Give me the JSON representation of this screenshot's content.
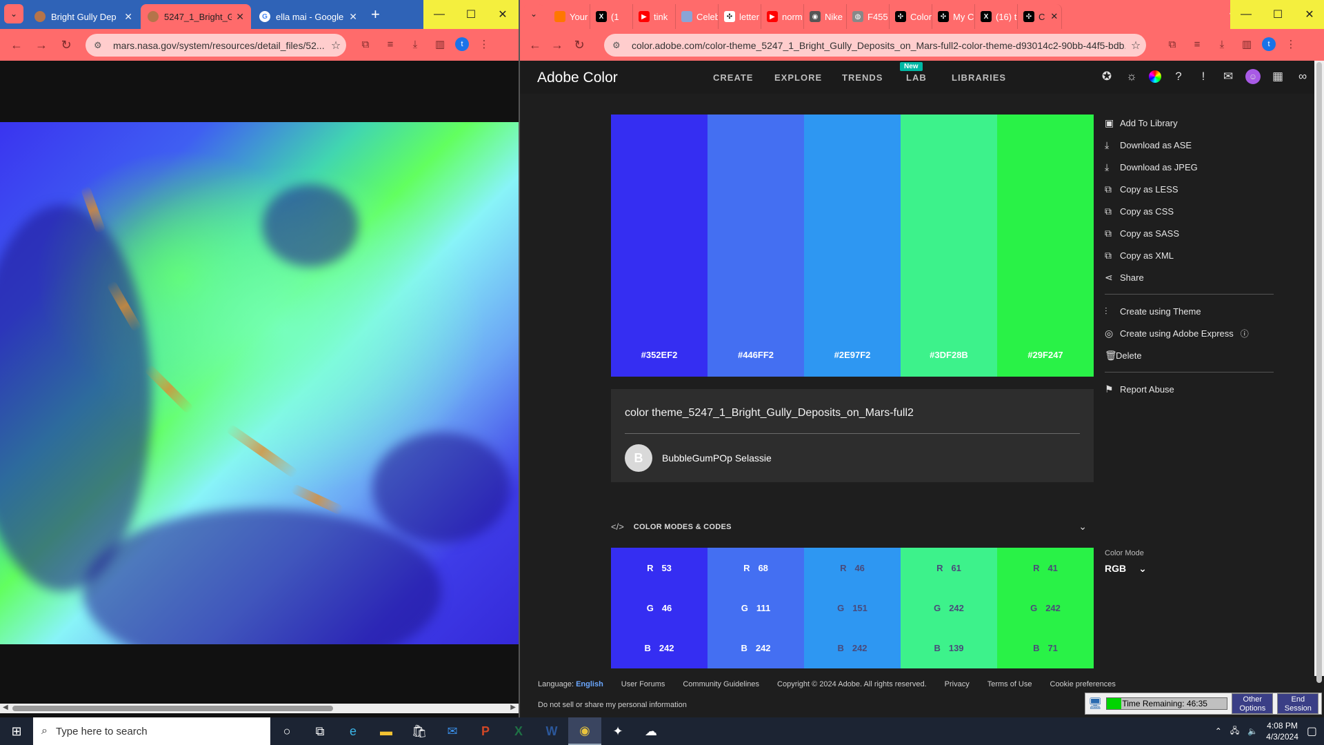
{
  "left_window": {
    "tabs": [
      {
        "title": "Bright Gully Dep",
        "favicon": "planet"
      },
      {
        "title": "5247_1_Bright_G",
        "favicon": "planet",
        "active": true
      },
      {
        "title": "ella mai - Google",
        "favicon": "google"
      }
    ],
    "url": "mars.nasa.gov/system/resources/detail_files/52...",
    "profile_letter": "t"
  },
  "right_window": {
    "tabs": [
      {
        "title": "Your",
        "favicon": "soundcloud"
      },
      {
        "title": "(1",
        "favicon": "x"
      },
      {
        "title": "tink",
        "favicon": "youtube"
      },
      {
        "title": "Celeb",
        "favicon": "pattern"
      },
      {
        "title": "letter",
        "favicon": "openai"
      },
      {
        "title": "norm",
        "favicon": "youtube"
      },
      {
        "title": "Nike",
        "favicon": "eye"
      },
      {
        "title": "F455",
        "favicon": "globe"
      },
      {
        "title": "Color",
        "favicon": "openai"
      },
      {
        "title": "My C",
        "favicon": "openai"
      },
      {
        "title": "(16) t",
        "favicon": "x"
      },
      {
        "title": "C",
        "favicon": "openai",
        "active": true
      }
    ],
    "url": "color.adobe.com/color-theme_5247_1_Bright_Gully_Deposits_on_Mars-full2-color-theme-d93014c2-90bb-44f5-bdb...",
    "profile_letter": "t"
  },
  "adobe": {
    "brand": "Adobe Color",
    "nav": [
      "CREATE",
      "EXPLORE",
      "TRENDS",
      "LAB",
      "LIBRARIES"
    ],
    "new_badge": "New",
    "swatches": [
      {
        "hex": "#352EF2",
        "r": "53",
        "g": "46",
        "b": "242"
      },
      {
        "hex": "#446FF2",
        "r": "68",
        "g": "111",
        "b": "242"
      },
      {
        "hex": "#2E97F2",
        "r": "46",
        "g": "151",
        "b": "242"
      },
      {
        "hex": "#3DF28B",
        "r": "61",
        "g": "242",
        "b": "139"
      },
      {
        "hex": "#29F247",
        "r": "41",
        "g": "242",
        "b": "71"
      }
    ],
    "actions_group1": [
      {
        "label": "Add To Library",
        "icon": "library-icon"
      },
      {
        "label": "Download as ASE",
        "icon": "download-icon"
      },
      {
        "label": "Download as JPEG",
        "icon": "download-icon"
      },
      {
        "label": "Copy as LESS",
        "icon": "copy-icon"
      },
      {
        "label": "Copy as CSS",
        "icon": "copy-icon"
      },
      {
        "label": "Copy as SASS",
        "icon": "copy-icon"
      },
      {
        "label": "Copy as XML",
        "icon": "copy-icon"
      },
      {
        "label": "Share",
        "icon": "share-icon"
      }
    ],
    "actions_group2": [
      {
        "label": "Create using Theme",
        "icon": "theme-icon"
      },
      {
        "label": "Create using Adobe Express",
        "icon": "express-icon"
      },
      {
        "label": "Delete",
        "icon": "trash-icon"
      }
    ],
    "actions_group3": [
      {
        "label": "Report Abuse",
        "icon": "flag-icon"
      }
    ],
    "theme_title": "color theme_5247_1_Bright_Gully_Deposits_on_Mars-full2",
    "author_initial": "B",
    "author_name": "BubbleGumPOp Selassie",
    "modes_label": "COLOR MODES & CODES",
    "color_mode_label": "Color Mode",
    "color_mode_value": "RGB",
    "rgb_labels": {
      "r": "R",
      "g": "G",
      "b": "B"
    }
  },
  "footer": {
    "language_label": "Language:",
    "language_value": "English",
    "links": [
      "User Forums",
      "Community Guidelines",
      "Copyright © 2024 Adobe. All rights reserved.",
      "Privacy",
      "Terms of Use",
      "Cookie preferences"
    ],
    "line2": "Do not sell or share my personal information"
  },
  "timer": {
    "text": "Time Remaining: 46:35",
    "remaining_fraction": 0.12,
    "other_options": "Other Options",
    "end_session": "End Session"
  },
  "taskbar": {
    "search_placeholder": "Type here to search",
    "time": "4:08 PM",
    "date": "4/3/2024"
  }
}
